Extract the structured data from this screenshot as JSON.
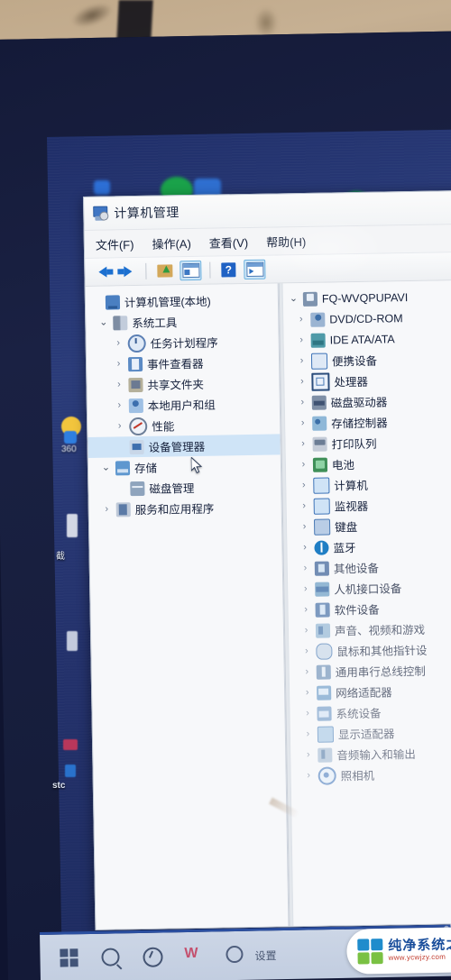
{
  "window": {
    "title": "计算机管理",
    "icon": "computer-management-icon",
    "menus": [
      "文件(F)",
      "操作(A)",
      "查看(V)",
      "帮助(H)"
    ],
    "toolbar": [
      {
        "name": "back-arrow-icon",
        "label": "后退"
      },
      {
        "name": "forward-arrow-icon",
        "label": "前进"
      },
      {
        "name": "up-folder-icon",
        "label": "上移"
      },
      {
        "name": "show-console-tree-icon",
        "label": "显示/隐藏控制台树"
      },
      {
        "name": "help-icon",
        "label": "帮助"
      },
      {
        "name": "show-action-pane-icon",
        "label": "显示/隐藏操作窗格"
      }
    ]
  },
  "tree": [
    {
      "label": "计算机管理(本地)",
      "indent": 0,
      "chevron": "",
      "icon": "computer",
      "selected": false
    },
    {
      "label": "系统工具",
      "indent": 1,
      "chevron": "v",
      "icon": "tools",
      "selected": false
    },
    {
      "label": "任务计划程序",
      "indent": 2,
      "chevron": ">",
      "icon": "clock",
      "selected": false
    },
    {
      "label": "事件查看器",
      "indent": 2,
      "chevron": ">",
      "icon": "event",
      "selected": false
    },
    {
      "label": "共享文件夹",
      "indent": 2,
      "chevron": ">",
      "icon": "share",
      "selected": false
    },
    {
      "label": "本地用户和组",
      "indent": 2,
      "chevron": ">",
      "icon": "users",
      "selected": false
    },
    {
      "label": "性能",
      "indent": 2,
      "chevron": ">",
      "icon": "perf",
      "selected": false
    },
    {
      "label": "设备管理器",
      "indent": 2,
      "chevron": "",
      "icon": "devmgr",
      "selected": true
    },
    {
      "label": "存储",
      "indent": 1,
      "chevron": "v",
      "icon": "storage",
      "selected": false
    },
    {
      "label": "磁盘管理",
      "indent": 2,
      "chevron": "",
      "icon": "disk",
      "selected": false
    },
    {
      "label": "服务和应用程序",
      "indent": 1,
      "chevron": ">",
      "icon": "svc",
      "selected": false
    }
  ],
  "device_list": [
    {
      "label": "FQ-WVQPUPAVI",
      "indent": 0,
      "chevron": "v",
      "icon": "pc",
      "fade": 0
    },
    {
      "label": "DVD/CD-ROM",
      "indent": 1,
      "chevron": ">",
      "icon": "dvd",
      "fade": 0
    },
    {
      "label": "IDE ATA/ATA",
      "indent": 1,
      "chevron": ">",
      "icon": "ide",
      "fade": 0
    },
    {
      "label": "便携设备",
      "indent": 1,
      "chevron": ">",
      "icon": "portable",
      "fade": 0
    },
    {
      "label": "处理器",
      "indent": 1,
      "chevron": ">",
      "icon": "cpu",
      "fade": 0
    },
    {
      "label": "磁盘驱动器",
      "indent": 1,
      "chevron": ">",
      "icon": "hdd",
      "fade": 0
    },
    {
      "label": "存储控制器",
      "indent": 1,
      "chevron": ">",
      "icon": "ctrl",
      "fade": 0
    },
    {
      "label": "打印队列",
      "indent": 1,
      "chevron": ">",
      "icon": "print",
      "fade": 0
    },
    {
      "label": "电池",
      "indent": 1,
      "chevron": ">",
      "icon": "batt",
      "fade": 0
    },
    {
      "label": "计算机",
      "indent": 1,
      "chevron": ">",
      "icon": "mon",
      "fade": 0
    },
    {
      "label": "监视器",
      "indent": 1,
      "chevron": ">",
      "icon": "mon",
      "fade": 0
    },
    {
      "label": "键盘",
      "indent": 1,
      "chevron": ">",
      "icon": "kbd",
      "fade": 0
    },
    {
      "label": "蓝牙",
      "indent": 1,
      "chevron": ">",
      "icon": "bt",
      "fade": 0
    },
    {
      "label": "其他设备",
      "indent": 1,
      "chevron": ">",
      "icon": "other",
      "fade": 1
    },
    {
      "label": "人机接口设备",
      "indent": 1,
      "chevron": ">",
      "icon": "hid",
      "fade": 1
    },
    {
      "label": "软件设备",
      "indent": 1,
      "chevron": ">",
      "icon": "soft",
      "fade": 1
    },
    {
      "label": "声音、视频和游戏",
      "indent": 1,
      "chevron": ">",
      "icon": "snd",
      "fade": 2
    },
    {
      "label": "鼠标和其他指针设",
      "indent": 1,
      "chevron": ">",
      "icon": "mouse",
      "fade": 2
    },
    {
      "label": "通用串行总线控制",
      "indent": 1,
      "chevron": ">",
      "icon": "usb",
      "fade": 2
    },
    {
      "label": "网络适配器",
      "indent": 1,
      "chevron": ">",
      "icon": "net",
      "fade": 2
    },
    {
      "label": "系统设备",
      "indent": 1,
      "chevron": ">",
      "icon": "sys",
      "fade": 3
    },
    {
      "label": "显示适配器",
      "indent": 1,
      "chevron": ">",
      "icon": "disp",
      "fade": 3
    },
    {
      "label": "音频输入和输出",
      "indent": 1,
      "chevron": ">",
      "icon": "audio",
      "fade": 3
    },
    {
      "label": "照相机",
      "indent": 1,
      "chevron": ">",
      "icon": "cam",
      "fade": 3
    }
  ],
  "desktop": {
    "icons": [
      {
        "label": "360",
        "name": "desktop-icon-360"
      },
      {
        "label": "截",
        "name": "desktop-icon-capture"
      },
      {
        "label": "stc",
        "name": "desktop-icon-stc"
      }
    ]
  },
  "taskbar": {
    "items": [
      {
        "name": "start-button",
        "label": "开始"
      },
      {
        "name": "search-icon",
        "label": "搜索"
      },
      {
        "name": "cortana-icon",
        "label": "Cortana"
      },
      {
        "name": "wps-icon",
        "label": "WPS"
      },
      {
        "name": "settings-icon",
        "label": "设置"
      }
    ],
    "settings_label": "设置"
  },
  "watermark": {
    "name_cn": "纯净系统之家",
    "url": "www.ycwjzy.com"
  },
  "colors": {
    "selection": "#cfe4f7",
    "accent": "#1f62c4",
    "desktop": "#24336e",
    "window_bg": "#f7f8fa"
  }
}
